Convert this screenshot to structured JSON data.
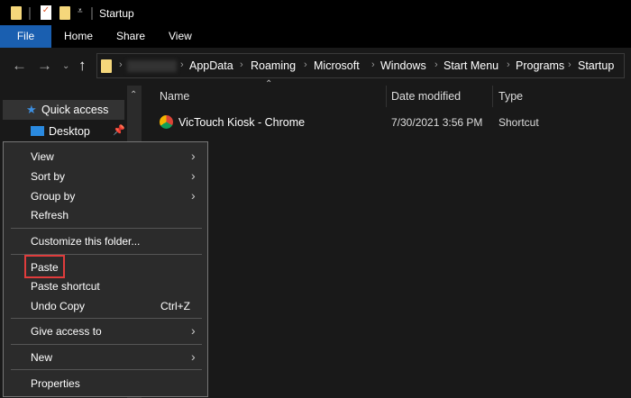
{
  "title": "Startup",
  "ribbon": {
    "tabs": [
      "File",
      "Home",
      "Share",
      "View"
    ]
  },
  "address": {
    "crumbs": [
      "AppData",
      "Roaming",
      "Microsoft",
      "Windows",
      "Start Menu",
      "Programs",
      "Startup"
    ]
  },
  "sidebar": {
    "items": [
      {
        "label": "Quick access"
      },
      {
        "label": "Desktop"
      }
    ]
  },
  "columns": {
    "name": "Name",
    "date": "Date modified",
    "type": "Type"
  },
  "files": [
    {
      "name": "VicTouch Kiosk - Chrome",
      "date": "7/30/2021 3:56 PM",
      "type": "Shortcut"
    }
  ],
  "menu": {
    "items": [
      {
        "label": "View"
      },
      {
        "label": "Sort by"
      },
      {
        "label": "Group by"
      },
      {
        "label": "Refresh"
      },
      {
        "label": "Customize this folder..."
      },
      {
        "label": "Paste"
      },
      {
        "label": "Paste shortcut"
      },
      {
        "label": "Undo Copy",
        "shortcut": "Ctrl+Z"
      },
      {
        "label": "Give access to"
      },
      {
        "label": "New"
      },
      {
        "label": "Properties"
      }
    ]
  },
  "colors": {
    "accent": "#1a5fb0",
    "highlight": "#e03c3c"
  }
}
